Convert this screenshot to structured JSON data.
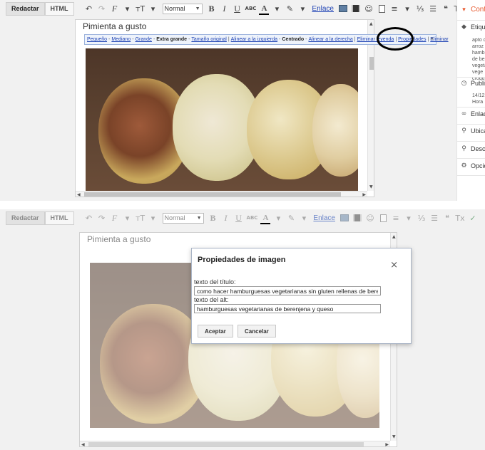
{
  "toolbar": {
    "compose_label": "Redactar",
    "html_label": "HTML",
    "font_size_value": "Normal",
    "link_label": "Enlace"
  },
  "editor": {
    "heading_text": "Pimienta a gusto"
  },
  "image_bubble": {
    "size_small": "Pequeño",
    "size_medium": "Mediano",
    "size_large": "Grande",
    "size_xlarge": "Extra grande",
    "size_original": "Tamaño original",
    "align_left": "Alinear a la izquierda",
    "align_center": "Centrado",
    "align_right": "Alinear a la derecha",
    "remove_caption": "Eliminar leyenda",
    "properties": "Propiedades",
    "delete": "Eliminar",
    "close_symbol": "×"
  },
  "sidebar": {
    "config_label": "Confi",
    "labels_title": "Etiqu",
    "labels_values": [
      "apto c",
      "arroz",
      "hamb",
      "de ber",
      "vegeta",
      "vege",
      "croqu"
    ],
    "published_title": "Publi",
    "published_values": [
      "14/12",
      "Hora"
    ],
    "links_title": "Enlac",
    "location_title": "Ubica",
    "description_title": "Descr",
    "options_title": "Opcio"
  },
  "dialog": {
    "title": "Propiedades de imagen",
    "close_symbol": "×",
    "title_label": "texto del título:",
    "title_value": "como hacer hamburguesas vegetarianas sin gluten rellenas de berenj",
    "alt_label": "texto del alt:",
    "alt_value": "hamburguesas vegetarianas de berenjena y queso",
    "accept_label": "Aceptar",
    "cancel_label": "Cancelar"
  },
  "icons": {
    "undo": "↶",
    "redo": "↷",
    "font": "F",
    "text_size": "тT",
    "bold": "B",
    "italic": "I",
    "underline": "U",
    "strike": "ABC",
    "text_color": "A",
    "highlight": "✎",
    "emoji": "☺",
    "align": "≡",
    "numbered": "⅓",
    "bulleted": "☰",
    "quote": "❝",
    "clear_format": "Tx",
    "spell": "✓",
    "tag": "◆",
    "clock": "◷",
    "link": "∞",
    "pin": "⚲",
    "search": "⚲",
    "gear": "⚙",
    "caret_down": "▾",
    "caret": "▼"
  },
  "colors": {
    "accent": "#e8562a",
    "link": "#1a3fb3",
    "toolbar_bg": "#f1f1f1"
  }
}
